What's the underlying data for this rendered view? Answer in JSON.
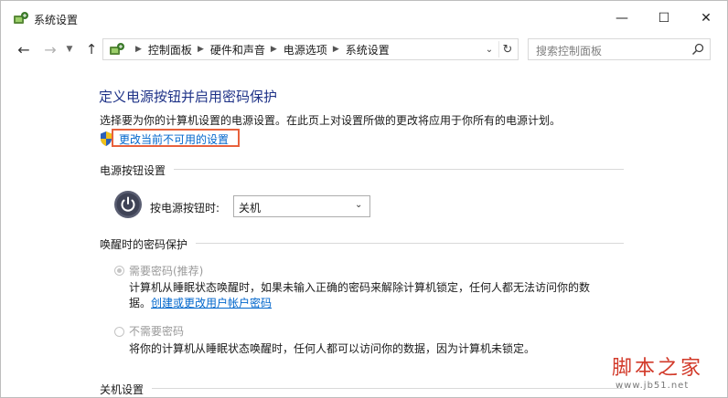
{
  "window": {
    "title": "系统设置",
    "controls": {
      "minimize": "—",
      "maximize": "☐",
      "close": "✕"
    }
  },
  "nav": {
    "back_icon": "arrow-left-icon",
    "forward_icon": "arrow-right-icon",
    "up_icon": "arrow-up-icon",
    "breadcrumbs": [
      "控制面板",
      "硬件和声音",
      "电源选项",
      "系统设置"
    ],
    "search_placeholder": "搜索控制面板"
  },
  "main": {
    "title": "定义电源按钮并启用密码保护",
    "description": "选择要为你的计算机设置的电源设置。在此页上对设置所做的更改将应用于你所有的电源计划。",
    "change_link": "更改当前不可用的设置",
    "power_section": {
      "heading": "电源按钮设置",
      "label": "按电源按钮时:",
      "selected": "关机"
    },
    "wake_section": {
      "heading": "唤醒时的密码保护",
      "option1": {
        "label": "需要密码(推荐)",
        "desc_line1": "计算机从睡眠状态唤醒时，如果未输入正确的密码来解除计算机锁定，任何人都无法访问你的数",
        "desc_line2_prefix": "据。",
        "desc_link": "创建或更改用户帐户密码",
        "checked": true
      },
      "option2": {
        "label": "不需要密码",
        "desc": "将你的计算机从睡眠状态唤醒时，任何人都可以访问你的数据，因为计算机未锁定。",
        "checked": false
      }
    },
    "shutdown_section": {
      "heading": "关机设置"
    }
  },
  "watermark": {
    "title": "脚本之家",
    "url": "www.jb51.net"
  },
  "colors": {
    "title_blue": "#1e3287",
    "link_blue": "#0066cc",
    "highlight_border": "#e8613c",
    "watermark_red": "#d23a2a"
  }
}
